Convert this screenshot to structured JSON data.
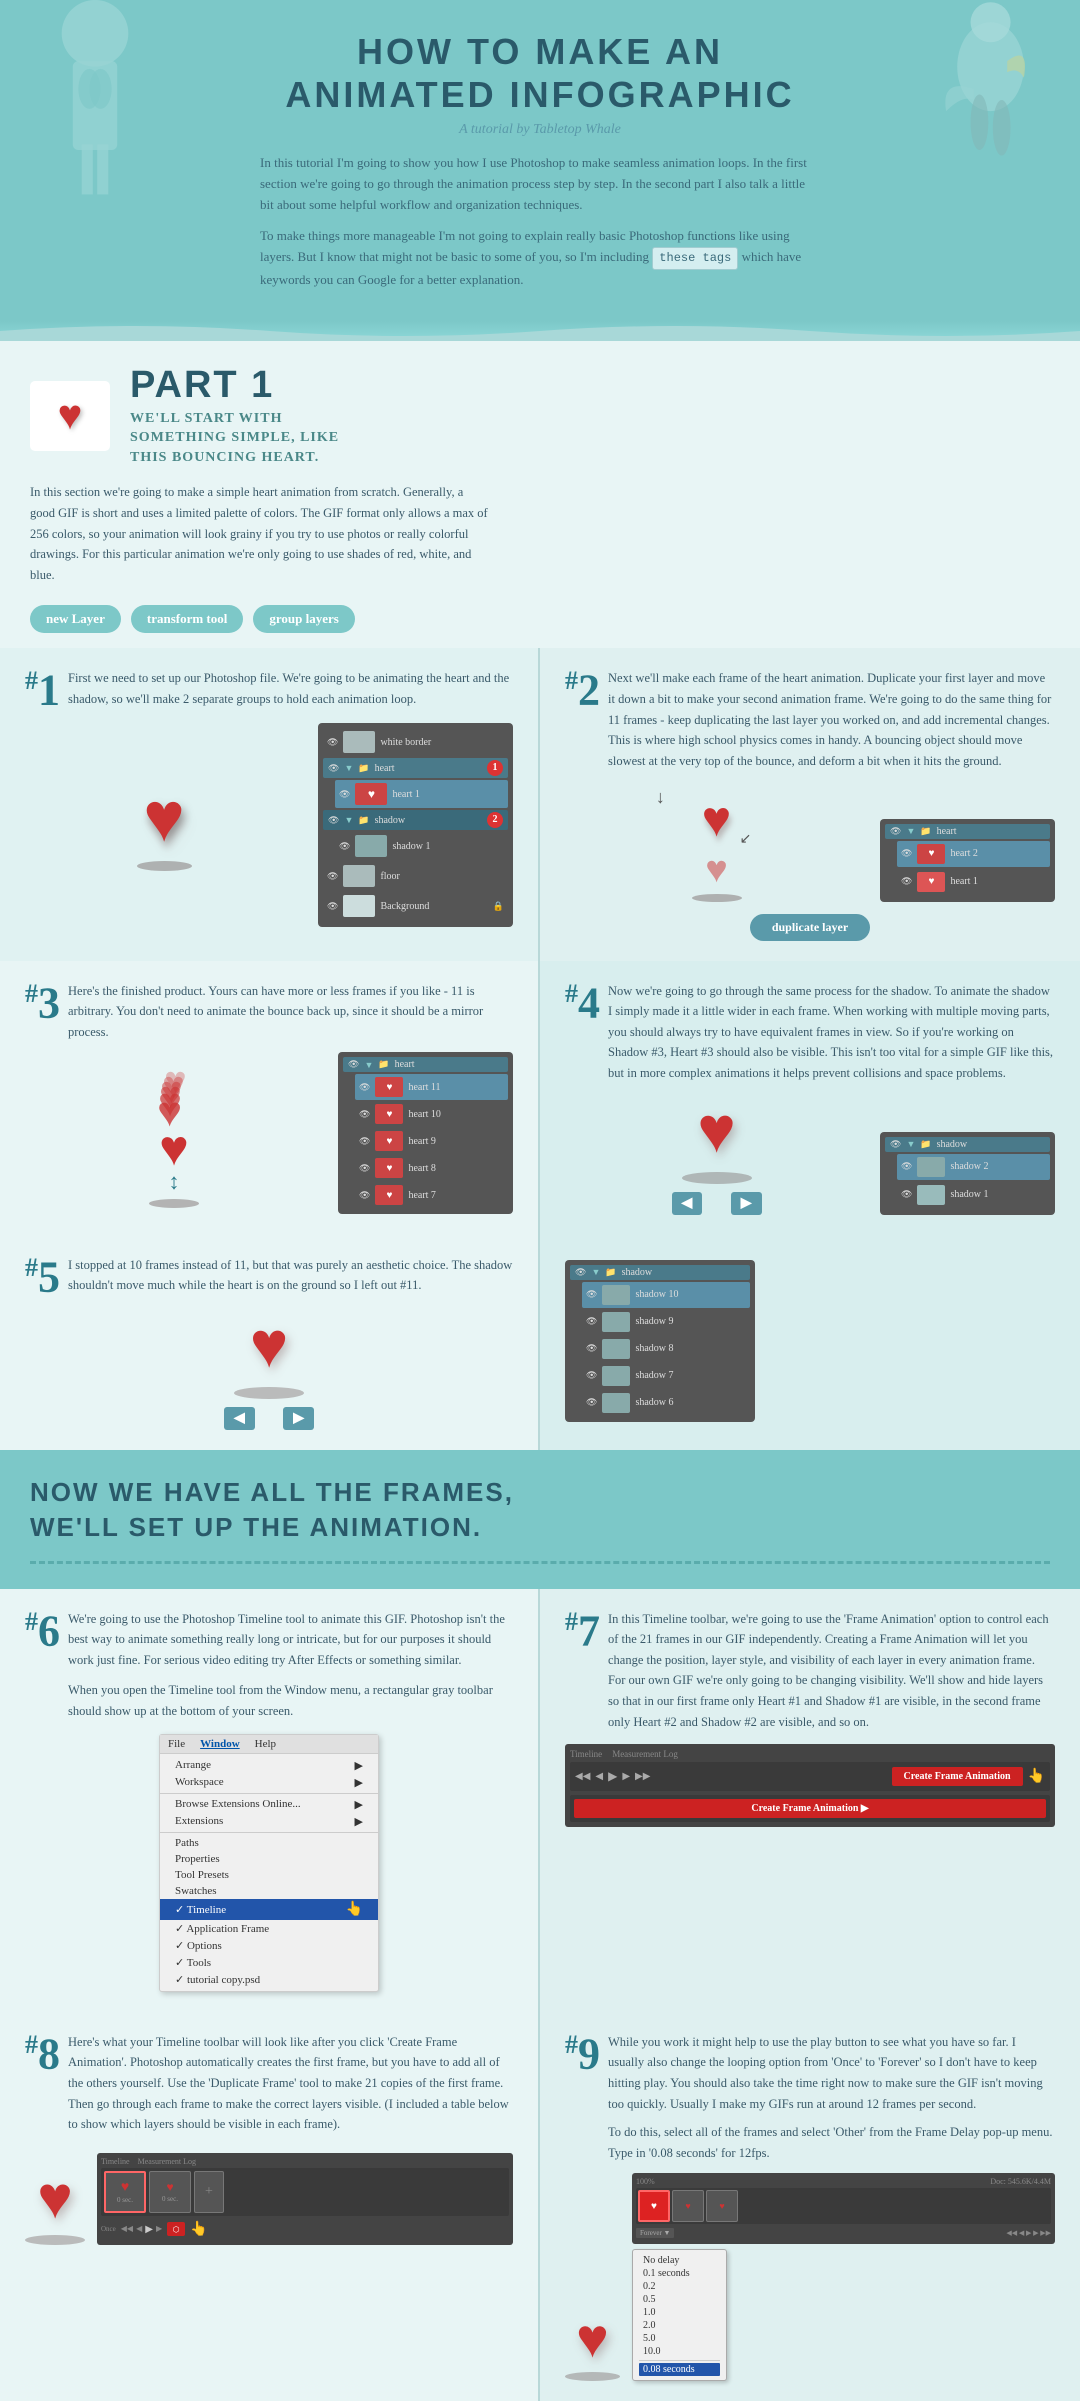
{
  "header": {
    "title_line1": "HOW TO MAKE AN",
    "title_line2": "ANIMATED INFOGRAPHIC",
    "subtitle": "A tutorial by Tabletop Whale",
    "body1": "In this tutorial I'm going to show you how I use Photoshop to make seamless animation loops. In the first section we're going to go through the animation process step by step. In the second part I also talk a little bit about some helpful workflow and organization techniques.",
    "body2": "To make things more manageable I'm not going to explain really basic Photoshop functions like using layers. But I know that might not be basic to some of you, so I'm including",
    "tag1": "these tags",
    "body3": "which have keywords you can Google for a better explanation."
  },
  "part1": {
    "label": "PART 1",
    "subtitle": "WE'LL START WITH SOMETHING SIMPLE, LIKE THIS BOUNCING HEART.",
    "body": "In this section we're going to make a simple heart animation from scratch. Generally, a good GIF is short and uses a limited palette of colors. The GIF format only allows a max of 256 colors, so your animation will look grainy if you try to use photos or really colorful drawings. For this particular animation we're only going to use shades of red, white, and blue.",
    "tag1": "new Layer",
    "tag2": "transform tool",
    "tag3": "group layers"
  },
  "step1": {
    "number": "#1",
    "body": "First we need to set up our Photoshop file. We're going to be animating the heart and the shadow, so we'll make 2 separate groups to hold each animation loop.",
    "layers": {
      "border": "white border",
      "group1": "heart",
      "heart1": "heart 1",
      "group2": "shadow",
      "shadow1": "shadow 1",
      "floor": "floor",
      "bg": "Background"
    },
    "badges": [
      "1",
      "2"
    ]
  },
  "step2": {
    "number": "#2",
    "body": "Next we'll make each frame of the heart animation. Duplicate your first layer and move it down a bit to make your second animation frame. We're going to do the same thing for 11 frames - keep duplicating the last layer you worked on, and add incremental changes. This is where high school physics comes in handy. A bouncing object should move slowest at the very top of the bounce, and deform a bit when it hits the ground.",
    "layers": {
      "group": "heart",
      "heart2": "heart 2",
      "heart1": "heart 1"
    },
    "btn": "duplicate layer"
  },
  "step3": {
    "number": "#3",
    "body": "Here's the finished product. Yours can have more or less frames if you like - 11 is arbitrary. You don't need to animate the bounce back up, since it should be a mirror process.",
    "layers": {
      "group": "heart",
      "heart11": "heart 11",
      "heart10": "heart 10",
      "heart9": "heart 9",
      "heart8": "heart 8",
      "heart7": "heart 7"
    }
  },
  "step4": {
    "number": "#4",
    "body": "Now we're going to go through the same process for the shadow. To animate the shadow I simply made it a little wider in each frame. When working with multiple moving parts, you should always try to have equivalent frames in view. So if you're working on Shadow #3, Heart #3 should also be visible. This isn't too vital for a simple GIF like this, but in more complex animations it helps prevent collisions and space problems.",
    "layers": {
      "group": "shadow",
      "shadow2": "shadow 2",
      "shadow1": "shadow 1"
    }
  },
  "step5": {
    "number": "#5",
    "body": "I stopped at 10 frames instead of 11, but that was purely an aesthetic choice. The shadow shouldn't move much while the heart is on the ground so I left out #11.",
    "layers": {
      "group": "shadow",
      "shadow10": "shadow 10",
      "shadow9": "shadow 9",
      "shadow8": "shadow 8",
      "shadow7": "shadow 7",
      "shadow6": "shadow 6"
    }
  },
  "animation_section": {
    "title_line1": "NOW WE HAVE ALL THE FRAMES,",
    "title_line2": "WE'LL SET UP THE ANIMATION."
  },
  "step6": {
    "number": "#6",
    "body1": "We're going to use the Photoshop Timeline tool to animate this GIF. Photoshop isn't the best way to animate something really long or intricate, but for our purposes it should work just fine. For serious video editing try After Effects or something similar.",
    "body2": "When you open the Timeline tool from the Window menu, a rectangular gray toolbar should show up at the bottom of your screen.",
    "menu": {
      "bar_items": [
        "File",
        "Window",
        "Help"
      ],
      "active": "Window",
      "items": [
        "Arrange",
        "Workspace",
        "Browse Extensions Online...",
        "Extensions",
        "Paths",
        "Properties",
        "Tool Presets",
        "Swatches",
        "Timeline",
        "Application Frame",
        "Options",
        "Tools",
        "tutorial copy.psd"
      ]
    }
  },
  "step7": {
    "number": "#7",
    "body": "In this Timeline toolbar, we're going to use the 'Frame Animation' option to control each of the 21 frames in our GIF independently. Creating a Frame Animation will let you change the position, layer style, and visibility of each layer in every animation frame. For our own GIF we're only going to be changing visibility. We'll show and hide layers so that in our first frame only Heart #1 and Shadow #1 are visible, in the second frame only Heart #2 and Shadow #2 are visible, and so on.",
    "btn": "Create Frame Animation"
  },
  "step8": {
    "number": "#8",
    "body": "Here's what your Timeline toolbar will look like after you click 'Create Frame Animation'. Photoshop automatically creates the first frame, but you have to add all of the others yourself. Use the 'Duplicate Frame' tool to make 21 copies of the first frame. Then go through each frame to make the correct layers visible. (I included a table below to show which layers should be visible in each frame).",
    "timeline": {
      "frame1_delay": "0 sec.",
      "frame2_delay": "0 sec.",
      "looping": "Once"
    }
  },
  "step9": {
    "number": "#9",
    "body1": "While you work it might help to use the play button to see what you have so far. I usually also change the looping option from 'Once' to 'Forever' so I don't have to keep hitting play. You should also take the time right now to make sure the GIF isn't moving too quickly. Usually I make my GIFs run at around 12 frames per second.",
    "body2": "To do this, select all of the frames and select 'Other' from the Frame Delay pop-up menu. Type in '0.08 seconds' for 12fps.",
    "delay_value": "0.08 seconds",
    "delay_options": [
      "No delay",
      "0.1 seconds",
      "0.2",
      "0.5",
      "1.0",
      "2.0",
      "5.0",
      "10.0"
    ],
    "highlighted_option": "0.08 seconds"
  },
  "icons": {
    "heart": "♥",
    "check": "✓",
    "arrow_right": "▶",
    "arrow_left": "◀",
    "arrow_double": "↔",
    "eye": "👁",
    "cursor": "👆"
  }
}
